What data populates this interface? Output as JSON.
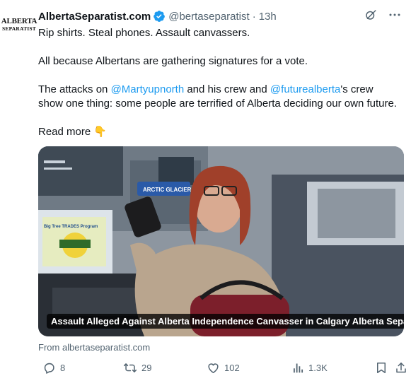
{
  "account": {
    "avatar_line1": "ALBERTA",
    "avatar_line2": "SEPARATIST",
    "display_name": "AlbertaSeparatist.com",
    "handle": "@bertaseparatist",
    "separator": "·",
    "time": "13h"
  },
  "post": {
    "line1": "Rip shirts. Steal phones. Assault canvassers.",
    "line2": "All because Albertans are gathering signatures for a vote.",
    "line3_a": "The attacks on ",
    "mention1": "@Martyupnorth",
    "line3_b": " and his crew and ",
    "mention2": "@futurealberta",
    "line3_c": "'s crew show one thing: some people are terrified of Alberta deciding our own future.",
    "read_more": "Read more 👇"
  },
  "card": {
    "caption": "Assault Alleged Against Alberta Independence Canvasser in Calgary Alberta Sepa...",
    "from": "From albertaseparatist.com",
    "sign_text": "ARCTIC GLACIER",
    "box_text": "Big Tree TRADES Program"
  },
  "stats": {
    "replies": "8",
    "reposts": "29",
    "likes": "102",
    "views": "1.3K"
  },
  "colors": {
    "accent": "#1d9bf0",
    "secondary_text": "#536471",
    "verified": "#1d9bf0"
  },
  "icons": {
    "verified": "verified-badge-icon",
    "grok": "grok-icon",
    "more": "more-options-icon",
    "reply": "reply-icon",
    "repost": "repost-icon",
    "like": "like-icon",
    "views": "views-icon",
    "bookmark": "bookmark-icon",
    "share": "share-icon"
  }
}
